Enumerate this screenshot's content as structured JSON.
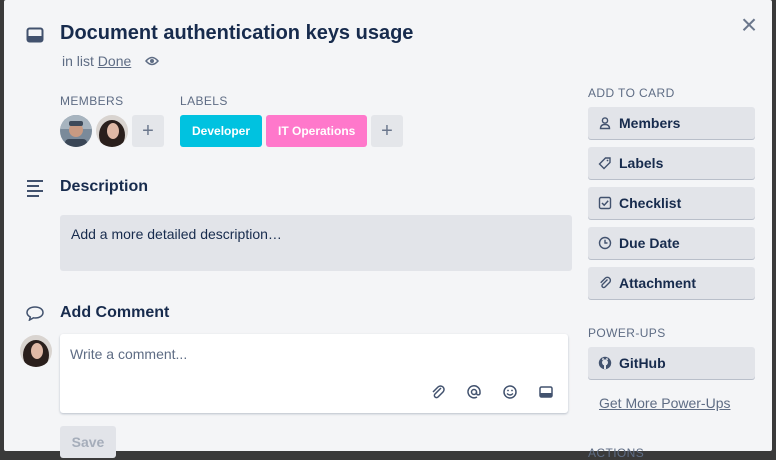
{
  "card": {
    "title": "Document authentication keys usage",
    "in_list_prefix": "in list",
    "list_name": "Done"
  },
  "members": {
    "heading": "MEMBERS",
    "add_symbol": "+"
  },
  "labels": {
    "heading": "LABELS",
    "items": [
      {
        "text": "Developer",
        "color": "#00c2e0"
      },
      {
        "text": "IT Operations",
        "color": "#ff78cb"
      }
    ],
    "add_symbol": "+"
  },
  "description": {
    "heading": "Description",
    "placeholder": "Add a more detailed description…"
  },
  "comment": {
    "heading": "Add Comment",
    "placeholder": "Write a comment...",
    "save_label": "Save"
  },
  "sidebar": {
    "add_to_card_heading": "ADD TO CARD",
    "buttons": [
      {
        "label": "Members",
        "icon": "person-icon"
      },
      {
        "label": "Labels",
        "icon": "tag-icon"
      },
      {
        "label": "Checklist",
        "icon": "checkbox-icon"
      },
      {
        "label": "Due Date",
        "icon": "clock-icon"
      },
      {
        "label": "Attachment",
        "icon": "paperclip-icon"
      }
    ],
    "powerups_heading": "POWER-UPS",
    "github_label": "GitHub",
    "get_more_label": "Get More Power-Ups",
    "actions_heading": "ACTIONS"
  },
  "colors": {
    "modal_bg": "#f4f5f7",
    "button_bg": "#e2e4e9",
    "text_primary": "#172b4d",
    "text_muted": "#5e6c84"
  }
}
